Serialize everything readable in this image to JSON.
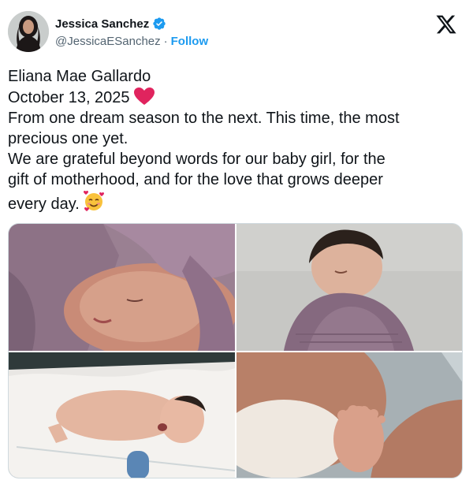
{
  "author": {
    "name": "Jessica Sanchez",
    "handle": "@JessicaESanchez",
    "separator": "·",
    "follow_label": "Follow"
  },
  "tweet": {
    "lines": [
      "Eliana Mae Gallardo",
      "October 13, 2025",
      "From one dream season to the next. This time, the most",
      "precious one yet.",
      "We are grateful beyond words for our baby girl, for the",
      "gift of motherhood, and for the love that grows deeper",
      "every day."
    ],
    "emojis": [
      "red-heart",
      "smiling-face-with-hearts"
    ]
  },
  "photos": [
    {
      "label": "newborn sleeping wrapped in lavender blanket"
    },
    {
      "label": "newborn swaddled in purple wrap"
    },
    {
      "label": "newborn crying in hospital bassinet"
    },
    {
      "label": "baby feet held by hand"
    }
  ],
  "colors": {
    "accent": "#1d9bf0",
    "heart": "#e0245e",
    "text": "#0f1419",
    "secondary_text": "#536471"
  }
}
